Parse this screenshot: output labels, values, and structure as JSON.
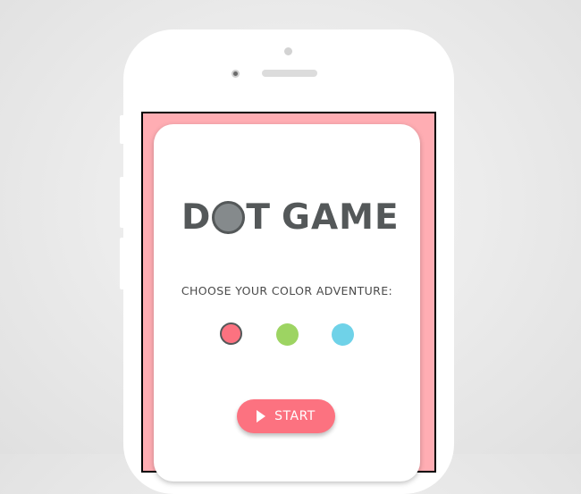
{
  "app": {
    "title_left": "D",
    "title_right": "T",
    "title_word2": "GAME"
  },
  "prompt": "CHOOSE YOUR COLOR ADVENTURE:",
  "colors": [
    {
      "name": "pink",
      "hex": "#fc7280",
      "selected": true
    },
    {
      "name": "green",
      "hex": "#9dd462",
      "selected": false
    },
    {
      "name": "blue",
      "hex": "#6fd2e8",
      "selected": false
    }
  ],
  "start_button": {
    "label": "START",
    "icon": "play-icon"
  },
  "theme": {
    "screen_bg": "#ffadb3",
    "title_color": "#545859",
    "title_dot_fill": "#858a8c"
  }
}
